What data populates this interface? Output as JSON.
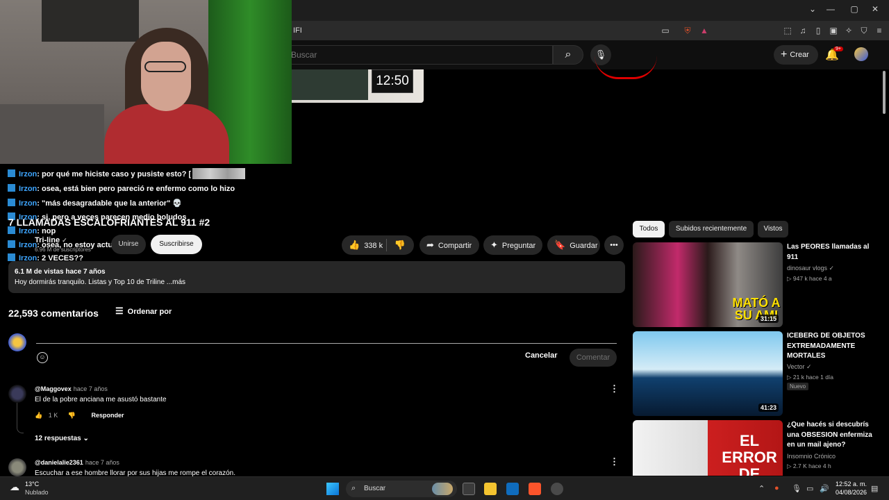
{
  "browser": {
    "url_fragment": "IFI",
    "window_controls": [
      "⌄",
      "—",
      "▢",
      "✕"
    ]
  },
  "yt_header": {
    "search_placeholder": "Buscar",
    "create_label": "Crear",
    "notification_badge": "9+"
  },
  "video": {
    "preview_time": "12:50",
    "title": "7 LLAMADAS ESCALOFRIANTES AL 911 #2",
    "channel": "Tri-line",
    "subscribers": "6.96 M de suscriptores",
    "join_label": "Unirse",
    "subscribe_label": "Suscribirse",
    "likes": "338 k",
    "share_label": "Compartir",
    "ask_label": "Preguntar",
    "save_label": "Guardar",
    "views_time": "6.1 M de vistas  hace 7 años",
    "description": "Hoy dormirás tranquilo. Listas y Top 10 de Triline ...más"
  },
  "chat": [
    {
      "user": "Irzon",
      "message": "por qué me hiciste caso y pusiste esto? [",
      "emotes": true
    },
    {
      "user": "Irzon",
      "message": "osea, está bien pero pareció re enfermo como lo hizo"
    },
    {
      "user": "Irzon",
      "message": "\"más desagradable que la anterior\" 💀"
    },
    {
      "user": "Irzon",
      "message": "si, pero a veces parecen medio boludos"
    },
    {
      "user": "Irzon",
      "message": "nop"
    },
    {
      "user": "Irzon",
      "message": "osea, no estoy actualizado d"
    },
    {
      "user": "Irzon",
      "message": "2 VECES??"
    }
  ],
  "comments": {
    "count": "22,593 comentarios",
    "sort_label": "Ordenar por",
    "cancel_label": "Cancelar",
    "submit_label": "Comentar",
    "items": [
      {
        "author": "@Maggovex",
        "time": "hace 7 años",
        "text": "El de la pobre anciana me asustó bastante",
        "likes": "1 K",
        "reply_label": "Responder",
        "replies": "12 respuestas"
      },
      {
        "author": "@danielalie2361",
        "time": "hace 7 años",
        "text": "Escuchar a ese hombre llorar por sus hijas me rompe el corazón."
      }
    ]
  },
  "sidebar": {
    "chips": [
      "Todos",
      "Subidos recientemente",
      "Vistos"
    ],
    "videos": [
      {
        "title": "Las PEORES llamadas al 911",
        "channel": "dinosaur vlogs ✓",
        "stats": "▷ 947 k   hace 4 a",
        "duration": "31:15",
        "thumb_text": "MATÓ A SU AMI"
      },
      {
        "title": "ICEBERG DE OBJETOS EXTREMADAMENTE MORTALES",
        "channel": "Vector ✓",
        "stats": "▷ 21 k   hace 1 día",
        "duration": "41:23",
        "badge": "Nuevo"
      },
      {
        "title": "¿Que hacés si descubrís una OBSESION enfermiza en un mail ajeno?",
        "channel": "Insomnio Crónico",
        "stats": "▷ 2.7 K   hace 4 h",
        "thumb_text1": "EL ERROR",
        "thumb_text2": "DE QUERER"
      }
    ]
  },
  "taskbar": {
    "temperature": "13°C",
    "condition": "Nublado",
    "search_label": "Buscar",
    "time": "12:52 a. m.",
    "date": "04/08/2026"
  }
}
